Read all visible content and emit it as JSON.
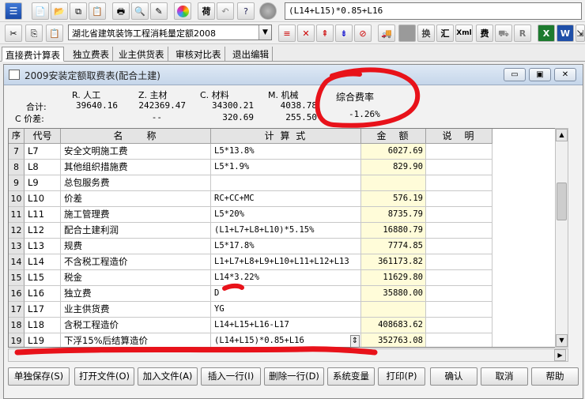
{
  "toolbar": {
    "formula_value": "(L14+L15)*0.85+L16",
    "quota_selected": "湖北省建筑装饰工程消耗量定额2008"
  },
  "tabs": [
    "直接费计算表",
    "独立费表",
    "业主供货表",
    "审核对比表",
    "退出编辑"
  ],
  "window": {
    "title": "2009安装定额取费表(配合土建)"
  },
  "summary": {
    "headers": [
      "R. 人工",
      "Z. 主材",
      "C. 材料",
      "M. 机械"
    ],
    "total_label": "合计:",
    "price_diff_label": "C 价差:",
    "total_values": [
      "39640.16",
      "242369.47",
      "34300.21",
      "4038.78"
    ],
    "price_diff_values": [
      "",
      "--",
      "320.69",
      "255.50"
    ],
    "rate_label": "综合费率",
    "rate_value": "-1.26%"
  },
  "grid": {
    "headers": [
      "序号",
      "代号",
      "名　　称",
      "计 算 式",
      "金　额",
      "说　明"
    ],
    "rows": [
      {
        "no": "7",
        "code": "L7",
        "name": "安全文明施工费",
        "formula": "L5*13.8%",
        "amount": "6027.69"
      },
      {
        "no": "8",
        "code": "L8",
        "name": "其他组织措施费",
        "formula": "L5*1.9%",
        "amount": "829.90"
      },
      {
        "no": "9",
        "code": "L9",
        "name": "总包服务费",
        "formula": "",
        "amount": ""
      },
      {
        "no": "10",
        "code": "L10",
        "name": "价差",
        "formula": "RC+CC+MC",
        "amount": "576.19"
      },
      {
        "no": "11",
        "code": "L11",
        "name": "施工管理费",
        "formula": "L5*20%",
        "amount": "8735.79"
      },
      {
        "no": "12",
        "code": "L12",
        "name": "配合土建利润",
        "formula": "(L1+L7+L8+L10)*5.15%",
        "amount": "16880.79"
      },
      {
        "no": "13",
        "code": "L13",
        "name": "规费",
        "formula": "L5*17.8%",
        "amount": "7774.85"
      },
      {
        "no": "14",
        "code": "L14",
        "name": "不含税工程造价",
        "formula": "L1+L7+L8+L9+L10+L11+L12+L13",
        "amount": "361173.82"
      },
      {
        "no": "15",
        "code": "L15",
        "name": "税金",
        "formula": "L14*3.22%",
        "amount": "11629.80"
      },
      {
        "no": "16",
        "code": "L16",
        "name": "独立费",
        "formula": "D",
        "amount": "35880.00"
      },
      {
        "no": "17",
        "code": "L17",
        "name": "业主供货费",
        "formula": "YG",
        "amount": ""
      },
      {
        "no": "18",
        "code": "L18",
        "name": "含税工程造价",
        "formula": "L14+L15+L16-L17",
        "amount": "408683.62"
      },
      {
        "no": "19",
        "code": "L19",
        "name": "下浮15%后结算造价",
        "formula": "(L14+L15)*0.85+L16",
        "amount": "352763.08"
      }
    ]
  },
  "buttons": [
    "单独保存(S)",
    "打开文件(O)",
    "加入文件(A)",
    "插入一行(I)",
    "删除一行(D)",
    "系统变量",
    "打印(P)",
    "确认",
    "取消",
    "帮助"
  ],
  "icons": {
    "tb1": [
      "menu-icon",
      "new-doc-icon",
      "open-doc-icon",
      "copy-doc-icon",
      "paste-doc-icon",
      "print-icon",
      "print-preview-icon",
      "note-icon",
      "color-wheel-icon",
      "fee-icon",
      "undo-icon",
      "help-icon",
      "record-icon"
    ],
    "tb2": [
      "cut-icon",
      "copy-icon",
      "paste-icon"
    ]
  },
  "colors": {
    "amount_bg": "#fffcd9",
    "annotation_red": "#e8121a"
  }
}
